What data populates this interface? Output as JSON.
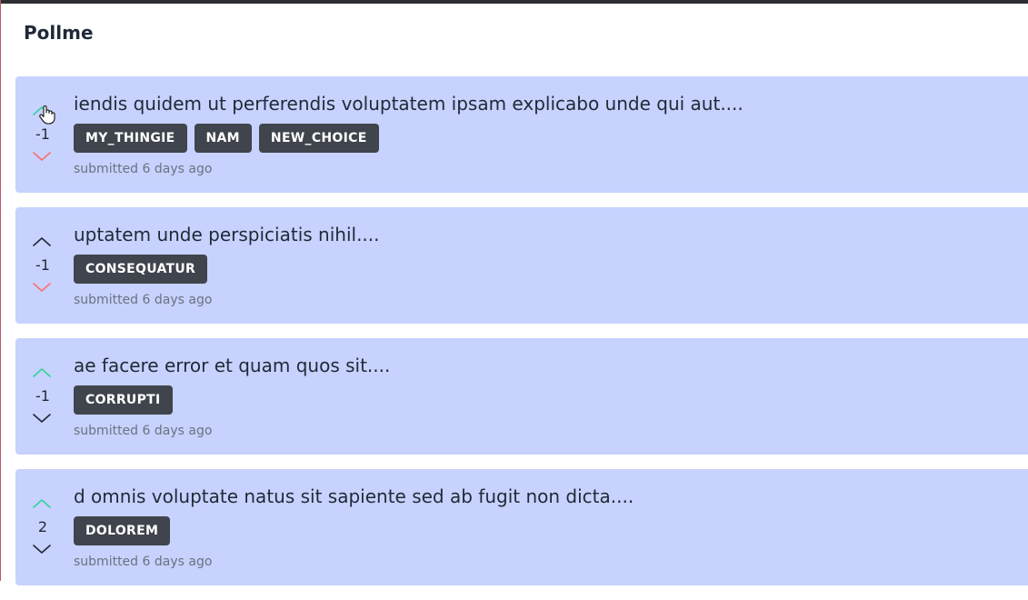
{
  "app": {
    "title": "Pollme"
  },
  "colors": {
    "card_bg": "#c7d2fe",
    "tag_bg": "#3f444d",
    "upvote_active": "#34d399",
    "downvote_active": "#f87171",
    "arrow_neutral": "#1f2937"
  },
  "polls": [
    {
      "title": "iendis quidem ut perferendis voluptatem ipsam explicabo unde qui aut....",
      "score": "-1",
      "tags": [
        "MY_THINGIE",
        "NAM",
        "NEW_CHOICE"
      ],
      "submitted": "submitted 6 days ago",
      "up_state": "active",
      "down_state": "active"
    },
    {
      "title": "uptatem unde perspiciatis nihil....",
      "score": "-1",
      "tags": [
        "CONSEQUATUR"
      ],
      "submitted": "submitted 6 days ago",
      "up_state": "neutral",
      "down_state": "active"
    },
    {
      "title": "ae facere error et quam quos sit....",
      "score": "-1",
      "tags": [
        "CORRUPTI"
      ],
      "submitted": "submitted 6 days ago",
      "up_state": "active",
      "down_state": "neutral"
    },
    {
      "title": "d omnis voluptate natus sit sapiente sed ab fugit non dicta....",
      "score": "2",
      "tags": [
        "DOLOREM"
      ],
      "submitted": "submitted 6 days ago",
      "up_state": "active",
      "down_state": "neutral"
    }
  ]
}
